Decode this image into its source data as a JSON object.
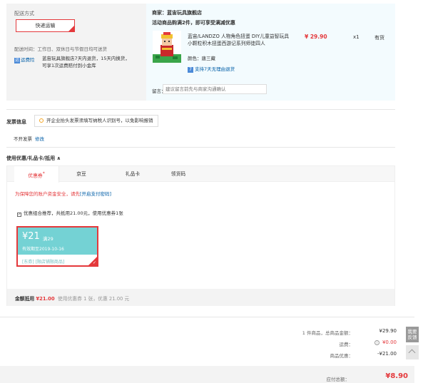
{
  "shipping": {
    "title": "配送方式",
    "method": "快递运输",
    "time": "配送时间：工作日、双休日与节假日均可送货",
    "freight_badge_icon": "运",
    "freight_badge": "运费险",
    "freight_desc": "蓝宙玩具旗舰店7天内退货，15天内换货，可享1次运费赔付到小金库"
  },
  "shop": {
    "name": "商家：蓝宙玩具旗舰店",
    "promo": "活动商品购满2件，即可享受满减优惠",
    "product": {
      "title": "蓝宙/LANDZO 人物角色扭蛋 DIY儿童益智玩具 小颗粒积木扭蛋西游记系列师徒四人",
      "price": "¥ 29.90",
      "qty": "x1",
      "stock": "有货",
      "color": "颜色：唐三藏",
      "return_icon": "7",
      "return_support": "支持7天无理由退货"
    },
    "remark_label": "留言：",
    "remark_placeholder": "建议留言前先与商家沟通确认"
  },
  "invoice": {
    "title": "发票信息",
    "tip": "开企业抬头发票须填写纳税人识别号，以免影响报销",
    "status": "不开发票",
    "modify": "修改"
  },
  "coupon": {
    "title": "使用优惠/礼品卡/抵用 ∧",
    "tabs": {
      "coupon": "优惠券",
      "coupon_mark": "*",
      "jd": "京豆",
      "gift": "礼品卡",
      "voucher": "领货码"
    },
    "security_tip": "为保障您的账户资金安全，请先",
    "security_link": "[开启支付密码]",
    "combo_check": "✓",
    "combo": "优惠组合推荐，共抵用21.00元，使用优惠券1张",
    "card": {
      "amount": "¥21",
      "cond": "满29",
      "validity": "有效期至2019-10-16",
      "scope": "[东券]  [限店铺限商品]",
      "tick": "✓"
    },
    "deduct": {
      "label": "金额抵用",
      "amount": "¥21.00",
      "desc": "使用优惠券 1 张，优惠 21.00 元"
    }
  },
  "summary": {
    "items_label": "1 件商品，总商品金额：",
    "items_value": "¥29.90",
    "shipping_label": "运费：",
    "shipping_info_icon": "i",
    "shipping_value": "¥0.00",
    "discount_label": "商品优惠：",
    "discount_value": "-¥21.00",
    "pay_label": "应付总额：",
    "pay_value": "¥8.90"
  },
  "side": {
    "feedback": "我要反馈"
  },
  "colors": {
    "accent": "#e4393c",
    "link": "#005ea7",
    "coupon": "#74d2d4"
  }
}
